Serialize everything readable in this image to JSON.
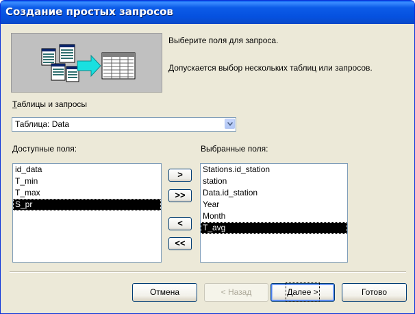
{
  "window": {
    "title": "Создание простых запросов"
  },
  "intro": {
    "line1": "Выберите поля для запроса.",
    "line2": "Допускается выбор нескольких таблиц или запросов."
  },
  "tables_label": "Таблицы и запросы",
  "tables_combo": {
    "value": "Таблица: Data"
  },
  "available": {
    "label": "Доступные поля:",
    "items": [
      "id_data",
      "T_min",
      "T_max",
      "S_pr"
    ],
    "selected_index": 3
  },
  "selected": {
    "label": "Выбранные поля:",
    "items": [
      "Stations.id_station",
      "station",
      "Data.id_station",
      "Year",
      "Month",
      "T_avg"
    ],
    "selected_index": 5
  },
  "move_buttons": {
    "add_one": ">",
    "add_all": ">>",
    "remove_one": "<",
    "remove_all": "<<"
  },
  "buttons": {
    "cancel": "Отмена",
    "back": "< Назад",
    "next": "Далее >",
    "finish": "Готово"
  },
  "colors": {
    "titlebar": "#0554e3",
    "dialog_bg": "#ece9d8",
    "selection": "#000000"
  }
}
